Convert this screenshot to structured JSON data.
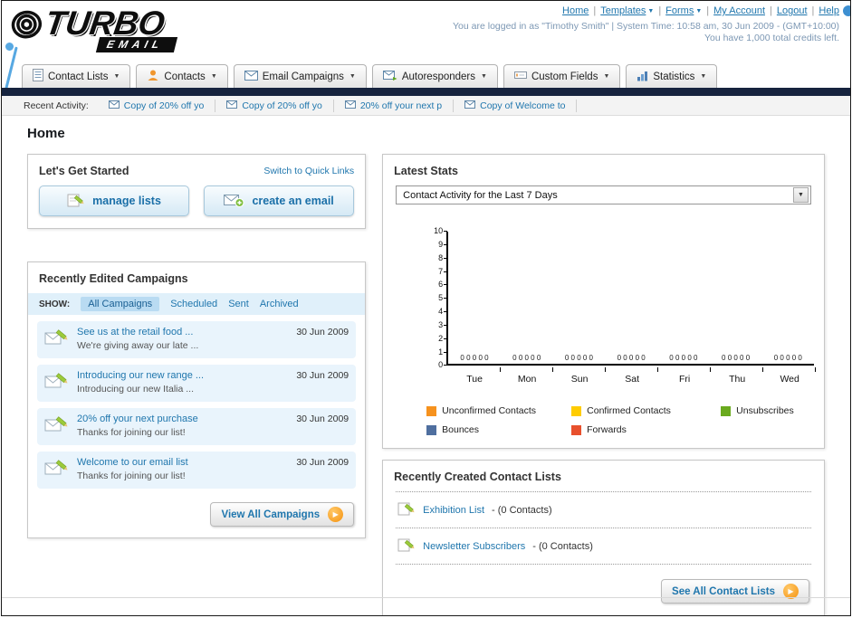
{
  "header": {
    "logo_title": "TURBO",
    "logo_subtitle": "EMAIL",
    "top_links": [
      "Home",
      "Templates",
      "Forms",
      "My Account",
      "Logout",
      "Help"
    ],
    "login_info": "You are logged in as \"Timothy Smith\" | System Time: 10:58 am, 30 Jun 2009 - (GMT+10:00)",
    "credits_info": "You have 1,000 total credits left."
  },
  "nav": {
    "tabs": [
      {
        "label": "Contact Lists"
      },
      {
        "label": "Contacts"
      },
      {
        "label": "Email Campaigns"
      },
      {
        "label": "Autoresponders"
      },
      {
        "label": "Custom Fields"
      },
      {
        "label": "Statistics"
      }
    ]
  },
  "recent_activity": {
    "label": "Recent Activity:",
    "items": [
      "Copy of 20% off yo",
      "Copy of 20% off yo",
      "20% off your next p",
      "Copy of Welcome to"
    ]
  },
  "page_title": "Home",
  "get_started": {
    "title": "Let's Get Started",
    "switch_link": "Switch to Quick Links",
    "manage_label": "manage lists",
    "create_label": "create an email"
  },
  "campaigns": {
    "title": "Recently Edited Campaigns",
    "show_label": "SHOW:",
    "filters": [
      "All Campaigns",
      "Scheduled",
      "Sent",
      "Archived"
    ],
    "active_filter": "All Campaigns",
    "items": [
      {
        "title": "See us at the retail food ...",
        "subtitle": "We're giving away our late ...",
        "date": "30 Jun 2009"
      },
      {
        "title": "Introducing our new range ...",
        "subtitle": "Introducing our new Italia ...",
        "date": "30 Jun 2009"
      },
      {
        "title": "20% off your next purchase",
        "subtitle": "Thanks for joining our list!",
        "date": "30 Jun 2009"
      },
      {
        "title": "Welcome to our email list",
        "subtitle": "Thanks for joining our list!",
        "date": "30 Jun 2009"
      }
    ],
    "view_all_label": "View All Campaigns"
  },
  "latest_stats": {
    "title": "Latest Stats",
    "dropdown_value": "Contact Activity for the Last 7 Days"
  },
  "chart_data": {
    "type": "bar",
    "title": "Contact Activity for the Last 7 Days",
    "categories": [
      "Tue",
      "Mon",
      "Sun",
      "Sat",
      "Fri",
      "Thu",
      "Wed"
    ],
    "series": [
      {
        "name": "Unconfirmed Contacts",
        "color": "#f6921e",
        "values": [
          0,
          0,
          0,
          0,
          0,
          0,
          0
        ]
      },
      {
        "name": "Confirmed Contacts",
        "color": "#ffcc00",
        "values": [
          0,
          0,
          0,
          0,
          0,
          0,
          0
        ]
      },
      {
        "name": "Unsubscribes",
        "color": "#6aaa1e",
        "values": [
          0,
          0,
          0,
          0,
          0,
          0,
          0
        ]
      },
      {
        "name": "Bounces",
        "color": "#4f6f9f",
        "values": [
          0,
          0,
          0,
          0,
          0,
          0,
          0
        ]
      },
      {
        "name": "Forwards",
        "color": "#e8502d",
        "values": [
          0,
          0,
          0,
          0,
          0,
          0,
          0
        ]
      }
    ],
    "ylim": [
      0,
      10
    ],
    "ytick_labels": [
      "10",
      "9",
      "8",
      "7",
      "6",
      "5",
      "4",
      "3",
      "2",
      "1",
      "0"
    ],
    "value_label_row": "0 0 0 0 0",
    "legend_position": "bottom",
    "grid": false
  },
  "contact_lists": {
    "title": "Recently Created Contact Lists",
    "items": [
      {
        "name": "Exhibition List",
        "suffix": "- (0 Contacts)"
      },
      {
        "name": "Newsletter Subscribers",
        "suffix": "- (0 Contacts)"
      }
    ],
    "see_all_label": "See All Contact Lists"
  },
  "icons": {
    "envelope-icon": "✉",
    "pencil-icon": "✎",
    "chevron-down-icon": "▼",
    "arrow-right-icon": "▶",
    "plus-icon": "+"
  },
  "colors": {
    "link_blue": "#1f76ad",
    "dark_bar": "#16233e",
    "accent_orange": "#f5920e"
  }
}
